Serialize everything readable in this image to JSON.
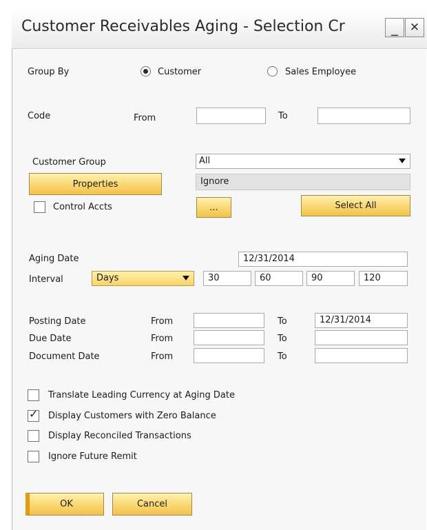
{
  "window": {
    "title": "Customer Receivables Aging - Selection Cr",
    "minimize": "_",
    "close": "✕"
  },
  "group_by": {
    "label": "Group By",
    "option_customer": "Customer",
    "option_sales_employee": "Sales Employee",
    "selected": "Customer"
  },
  "code": {
    "label": "Code",
    "from_label": "From",
    "to_label": "To",
    "from_value": "",
    "to_value": ""
  },
  "customer_group": {
    "label": "Customer Group",
    "value": "All"
  },
  "properties": {
    "button": "Properties",
    "value": "Ignore"
  },
  "control_accts": {
    "label": "Control Accts",
    "checked": false,
    "ellipsis_button": "...",
    "select_all_button": "Select All"
  },
  "aging": {
    "label": "Aging Date",
    "value": "12/31/2014",
    "interval_label": "Interval",
    "interval_value": "Days",
    "intervals": [
      "30",
      "60",
      "90",
      "120"
    ]
  },
  "dates": {
    "from_label": "From",
    "to_label": "To",
    "rows": [
      {
        "label": "Posting Date",
        "from": "",
        "to": "12/31/2014"
      },
      {
        "label": "Due Date",
        "from": "",
        "to": ""
      },
      {
        "label": "Document Date",
        "from": "",
        "to": ""
      }
    ]
  },
  "options": [
    {
      "label": "Translate Leading Currency at Aging Date",
      "checked": false
    },
    {
      "label": "Display Customers with Zero Balance",
      "checked": true
    },
    {
      "label": "Display Reconciled Transactions",
      "checked": false
    },
    {
      "label": "Ignore Future Remit",
      "checked": false
    }
  ],
  "footer": {
    "ok": "OK",
    "cancel": "Cancel"
  },
  "colors": {
    "button_yellow": "#f8d46a",
    "button_border": "#9d8a4a",
    "window_bg": "#f7f7f7"
  }
}
